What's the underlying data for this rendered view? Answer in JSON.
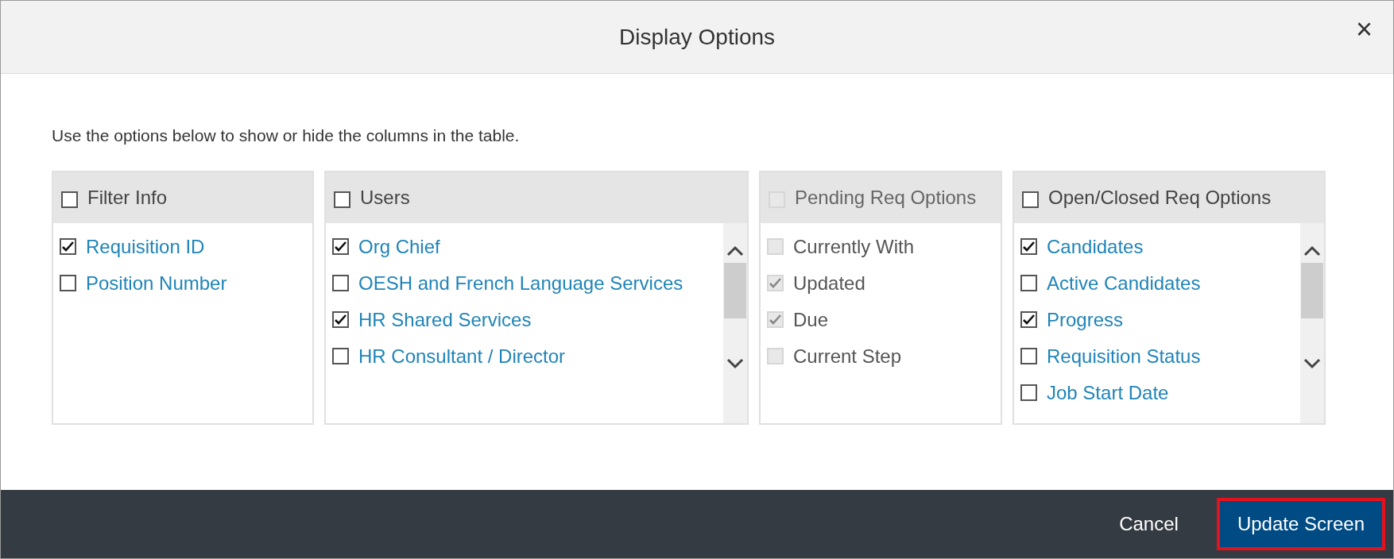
{
  "dialog": {
    "title": "Display Options",
    "close": "×"
  },
  "intro": "Use the options below to show or hide the columns in the table.",
  "panels": [
    {
      "title": "Filter Info",
      "checked": false,
      "disabled": false,
      "scrollable": false,
      "items": [
        {
          "label": "Requisition ID",
          "checked": true,
          "disabled": false
        },
        {
          "label": "Position Number",
          "checked": false,
          "disabled": false
        }
      ]
    },
    {
      "title": "Users",
      "checked": false,
      "disabled": false,
      "scrollable": true,
      "items": [
        {
          "label": "Org Chief",
          "checked": true,
          "disabled": false
        },
        {
          "label": "OESH and French Language Services",
          "checked": false,
          "disabled": false
        },
        {
          "label": "HR Shared Services",
          "checked": true,
          "disabled": false
        },
        {
          "label": "HR Consultant / Director",
          "checked": false,
          "disabled": false
        }
      ]
    },
    {
      "title": "Pending Req Options",
      "checked": false,
      "disabled": true,
      "scrollable": false,
      "items": [
        {
          "label": "Currently With",
          "checked": false,
          "disabled": true
        },
        {
          "label": "Updated",
          "checked": true,
          "disabled": true
        },
        {
          "label": "Due",
          "checked": true,
          "disabled": true
        },
        {
          "label": "Current Step",
          "checked": false,
          "disabled": true
        }
      ]
    },
    {
      "title": "Open/Closed Req Options",
      "checked": false,
      "disabled": false,
      "scrollable": true,
      "items": [
        {
          "label": "Candidates",
          "checked": true,
          "disabled": false
        },
        {
          "label": "Active Candidates",
          "checked": false,
          "disabled": false
        },
        {
          "label": "Progress",
          "checked": true,
          "disabled": false
        },
        {
          "label": "Requisition Status",
          "checked": false,
          "disabled": false
        },
        {
          "label": "Job Start Date",
          "checked": false,
          "disabled": false
        }
      ]
    }
  ],
  "buttons": [
    {
      "label": "Cancel",
      "kind": "plain",
      "highlighted": false
    },
    {
      "label": "Update Screen",
      "kind": "primary",
      "highlighted": true
    }
  ]
}
